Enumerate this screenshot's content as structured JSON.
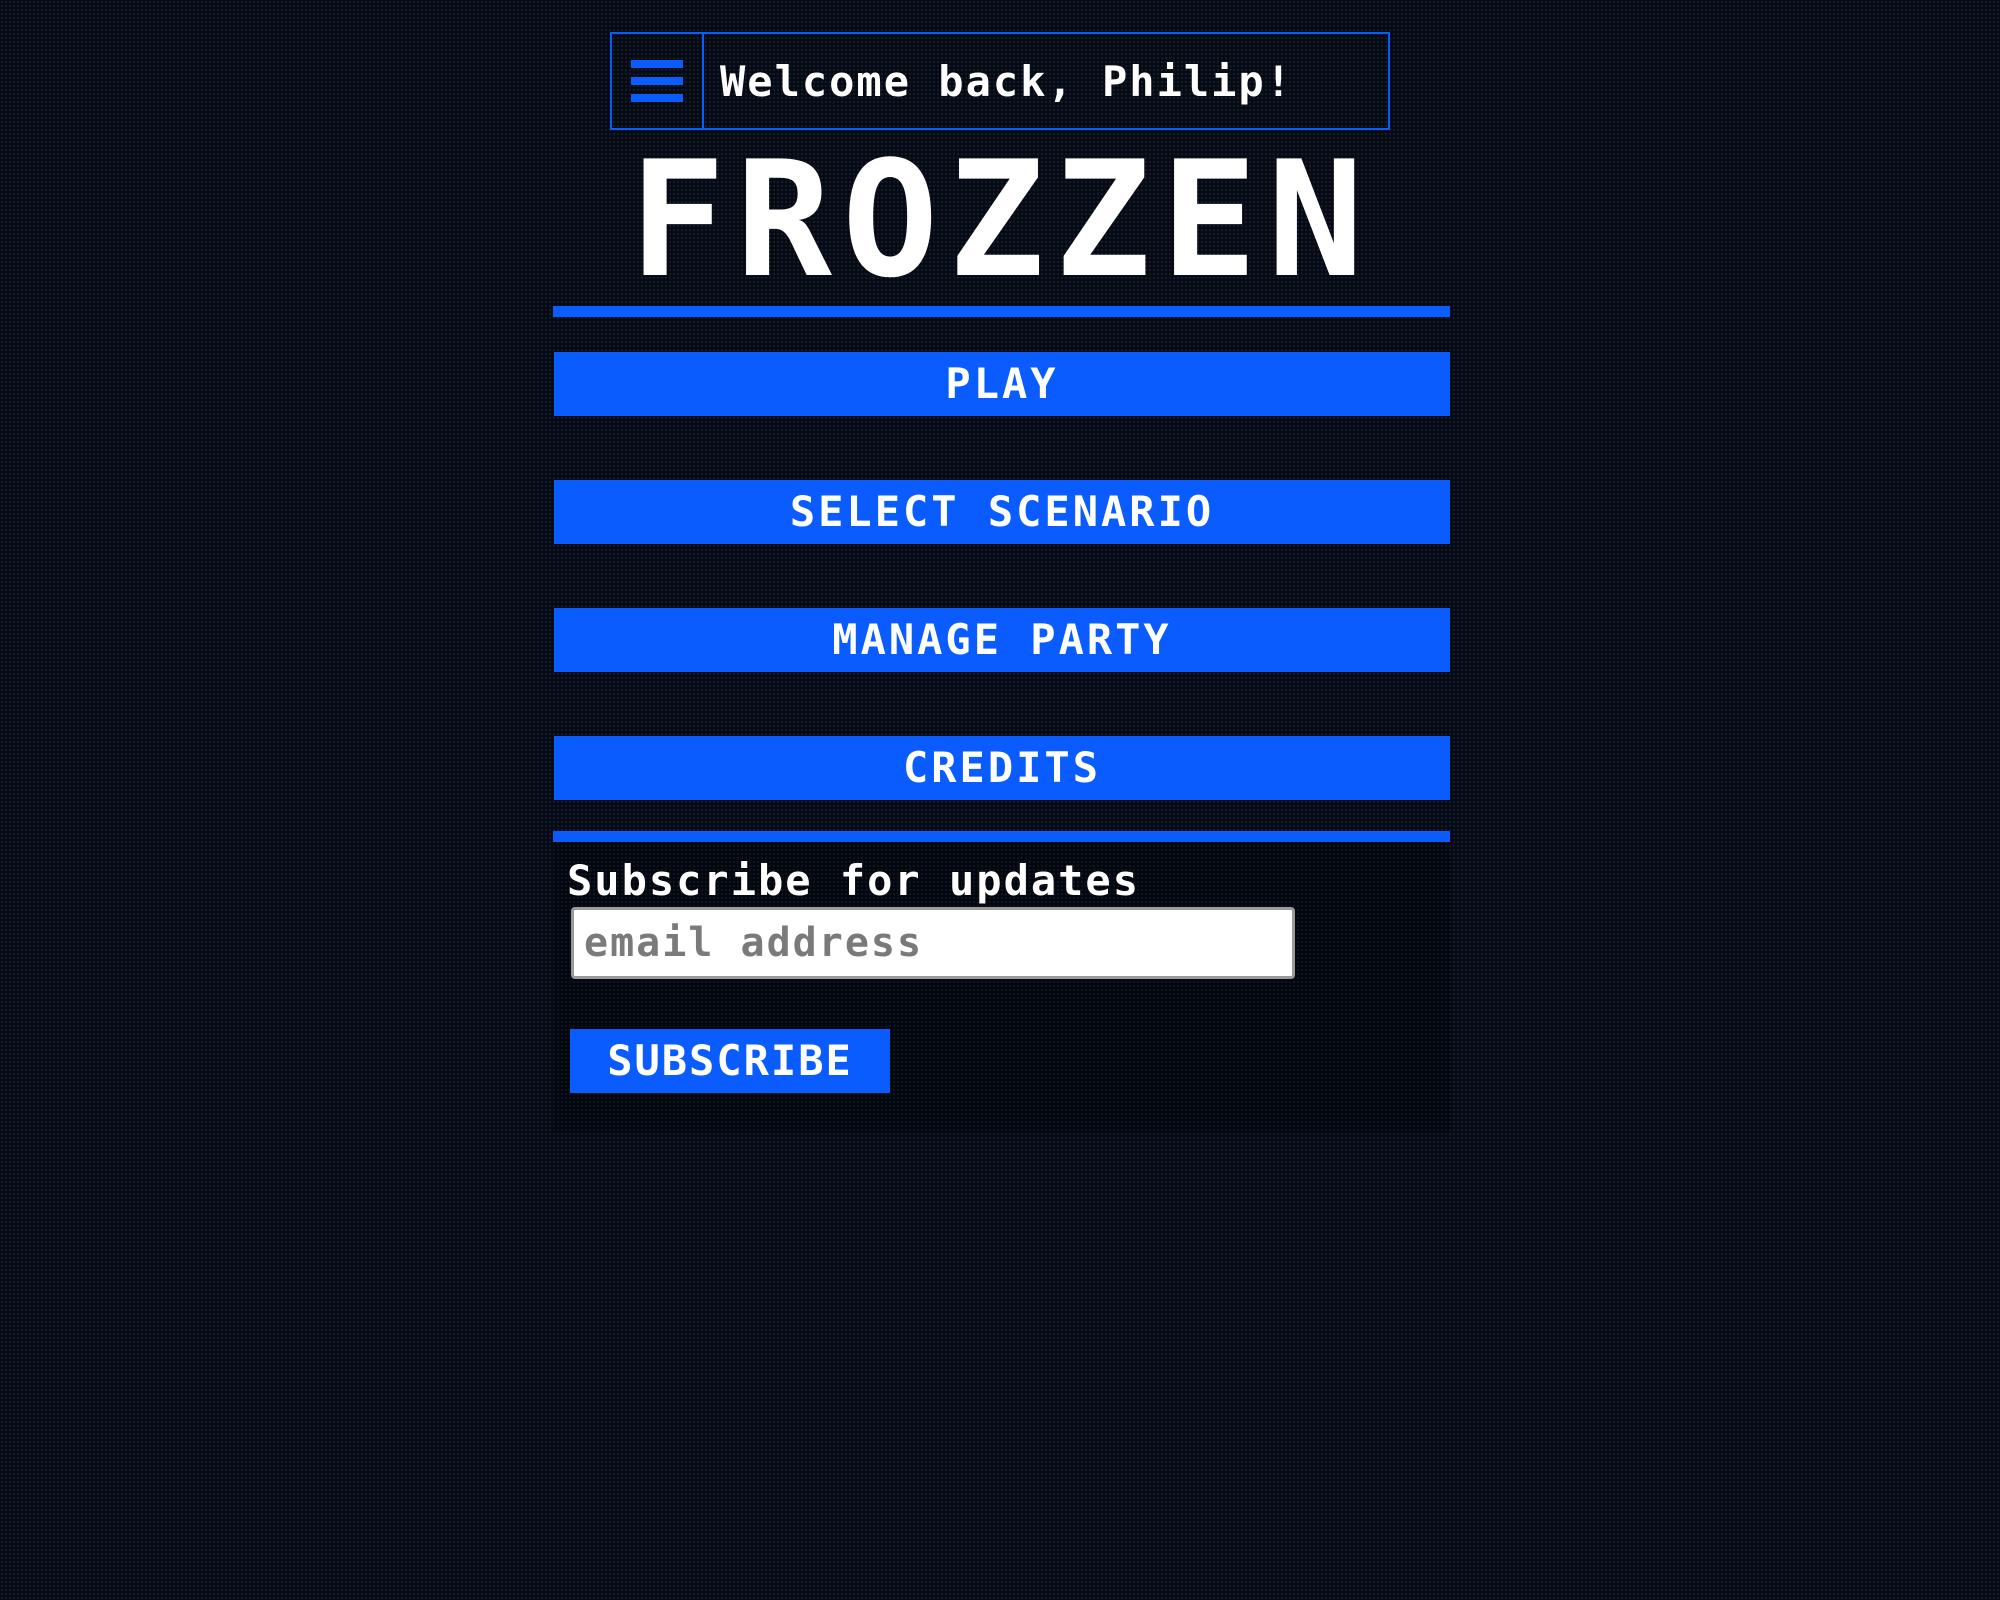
{
  "header": {
    "menu_icon": "hamburger-menu-icon",
    "welcome_text": "Welcome back, Philip!"
  },
  "title": "FROZZEN",
  "menu": {
    "play_label": "PLAY",
    "select_scenario_label": "SELECT SCENARIO",
    "manage_party_label": "MANAGE PARTY",
    "credits_label": "CREDITS"
  },
  "subscribe": {
    "label": "Subscribe for updates",
    "email_placeholder": "email address",
    "email_value": "",
    "button_label": "SUBSCRIBE"
  },
  "colors": {
    "accent": "#0a5cff",
    "background": "#050a14",
    "text": "#ffffff"
  }
}
